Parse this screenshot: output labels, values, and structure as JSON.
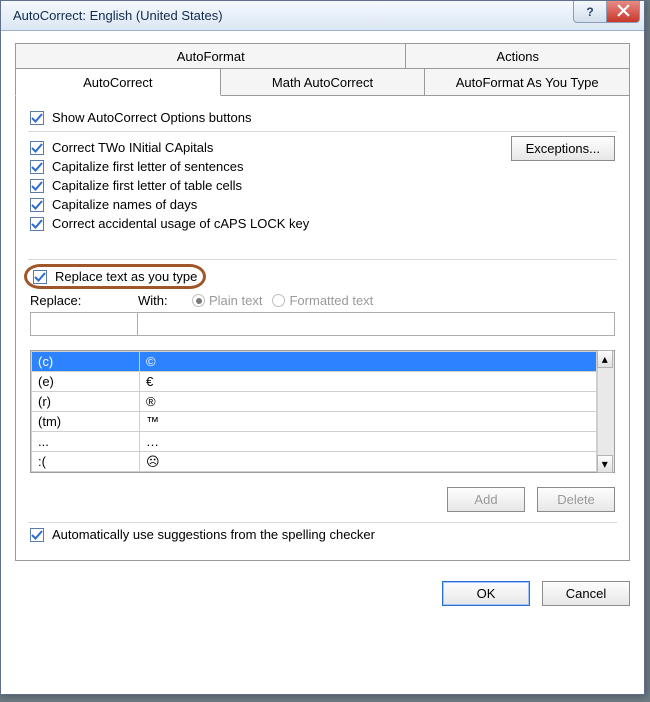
{
  "window_title": "AutoCorrect: English (United States)",
  "tabs_top": {
    "autoformat": "AutoFormat",
    "actions": "Actions"
  },
  "tabs_bottom": {
    "autocorrect": "AutoCorrect",
    "math": "Math AutoCorrect",
    "autoformat_as_type": "AutoFormat As You Type"
  },
  "checkboxes": {
    "show_buttons": "Show AutoCorrect Options buttons",
    "two_initial": "Correct TWo INitial CApitals",
    "first_sentence": "Capitalize first letter of sentences",
    "first_table": "Capitalize first letter of table cells",
    "names_days": "Capitalize names of days",
    "caps_lock": "Correct accidental usage of cAPS LOCK key",
    "replace_as_type": "Replace text as you type",
    "auto_spelling": "Automatically use suggestions from the spelling checker"
  },
  "buttons": {
    "exceptions": "Exceptions...",
    "add": "Add",
    "delete": "Delete",
    "ok": "OK",
    "cancel": "Cancel"
  },
  "labels": {
    "replace": "Replace:",
    "with": "With:",
    "plain_text": "Plain text",
    "formatted_text": "Formatted text"
  },
  "autocorrect_table": [
    {
      "from": "(c)",
      "to": "©"
    },
    {
      "from": "(e)",
      "to": "€"
    },
    {
      "from": "(r)",
      "to": "®"
    },
    {
      "from": "(tm)",
      "to": "™"
    },
    {
      "from": "...",
      "to": "…"
    },
    {
      "from": ":(",
      "to": "☹"
    }
  ]
}
